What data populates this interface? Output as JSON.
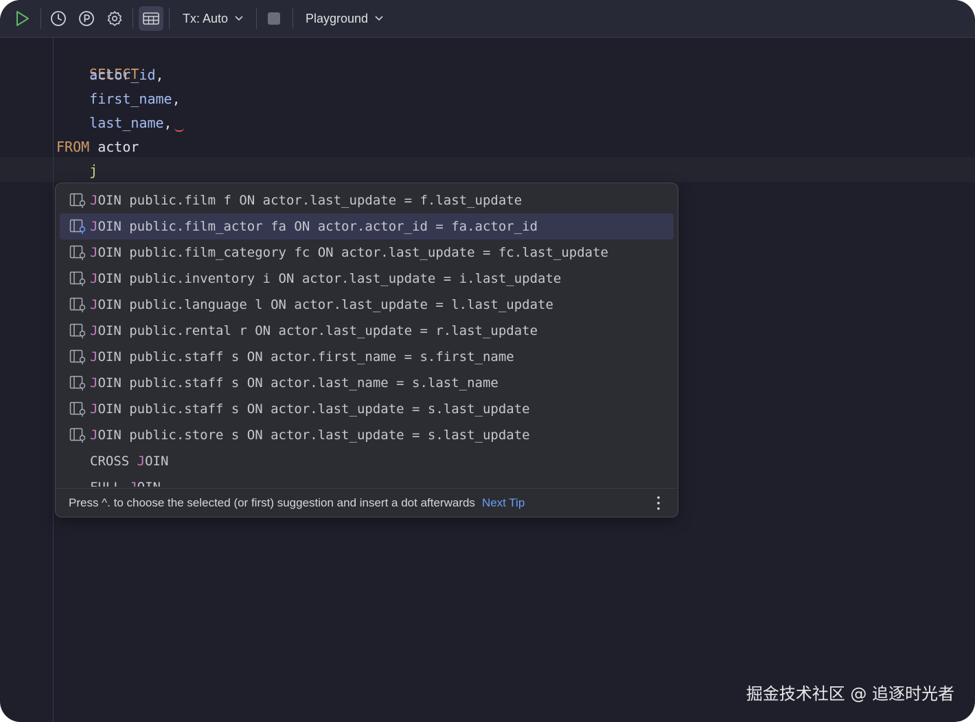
{
  "toolbar": {
    "tx_label": "Tx: Auto",
    "console_label": "Playground"
  },
  "editor": {
    "lines": [
      {
        "kw": "SELECT"
      },
      {
        "col": "actor_id",
        "punct": ","
      },
      {
        "col": "first_name",
        "punct": ","
      },
      {
        "col": "last_name",
        "punct": ","
      },
      {
        "kw": "FROM",
        "ident": "actor"
      },
      {
        "typed": "j"
      }
    ]
  },
  "completion": {
    "items": [
      {
        "match": "J",
        "text": "OIN public.film f ON actor.last_update = f.last_update"
      },
      {
        "match": "J",
        "text": "OIN public.film_actor fa ON actor.actor_id = fa.actor_id"
      },
      {
        "match": "J",
        "text": "OIN public.film_category fc ON actor.last_update = fc.last_update"
      },
      {
        "match": "J",
        "text": "OIN public.inventory i ON actor.last_update = i.last_update"
      },
      {
        "match": "J",
        "text": "OIN public.language l ON actor.last_update = l.last_update"
      },
      {
        "match": "J",
        "text": "OIN public.rental r ON actor.last_update = r.last_update"
      },
      {
        "match": "J",
        "text": "OIN public.staff s ON actor.first_name = s.first_name"
      },
      {
        "match": "J",
        "text": "OIN public.staff s ON actor.last_name = s.last_name"
      },
      {
        "match": "J",
        "text": "OIN public.staff s ON actor.last_update = s.last_update"
      },
      {
        "match": "J",
        "text": "OIN public.store s ON actor.last_update = s.last_update"
      },
      {
        "pre": "CROSS ",
        "match": "J",
        "text": "OIN"
      },
      {
        "pre": "FULL ",
        "match": "J",
        "text": "OIN"
      }
    ],
    "selected_index": 1,
    "footer_hint": "Press ^. to choose the selected (or first) suggestion and insert a dot afterwards",
    "footer_link": "Next Tip"
  },
  "watermark": "掘金技术社区 @ 追逐时光者",
  "colors": {
    "keyword": "#d49a66",
    "column": "#a6bdf2",
    "match": "#c77dbb",
    "link": "#6f9cf5",
    "run": "#5fb865"
  }
}
